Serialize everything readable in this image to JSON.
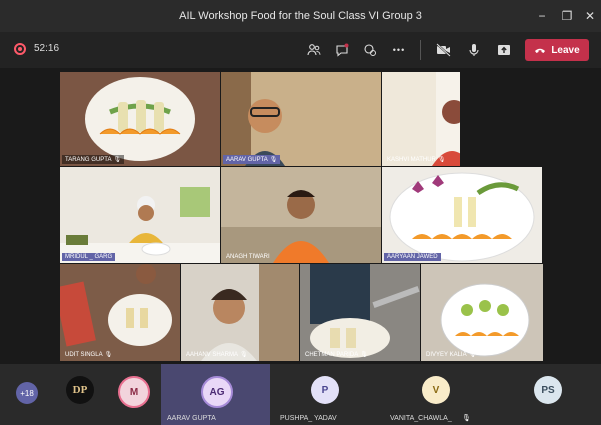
{
  "window": {
    "title": "AIL Workshop Food for the Soul Class VI Group 3",
    "minimize_glyph": "−",
    "maximize_glyph": "❐",
    "close_glyph": "✕"
  },
  "toolbar": {
    "timer": "52:16",
    "leave_label": "Leave",
    "more_glyph": "•••",
    "icons": [
      "participants-icon",
      "chat-icon",
      "reactions-icon",
      "more-icon",
      "camera-off-icon",
      "mic-icon",
      "share-icon"
    ]
  },
  "video_tiles": [
    {
      "name": "TARANG GUPTA",
      "highlight": false
    },
    {
      "name": "AARAV GUPTA",
      "highlight": true
    },
    {
      "name": "KASHVI MATHUR",
      "highlight": false
    },
    {
      "name": "MRIDUL _ GARG",
      "highlight": true
    },
    {
      "name": "ANAGH TIWARI",
      "highlight": false
    },
    {
      "name": "AARYAAN JAWED",
      "highlight": true
    },
    {
      "name": "UDIT SINGLA",
      "highlight": false
    },
    {
      "name": "AAHANV SHARMA",
      "highlight": false
    },
    {
      "name": "CHETMAN PARIDA",
      "highlight": false
    },
    {
      "name": "DIVYEY KALIA",
      "highlight": false
    }
  ],
  "bottom_bar": {
    "overflow_count": "+18",
    "participants": [
      {
        "initials": "DP",
        "name": "",
        "avatar_bg": "#111111",
        "avatar_fg": "#e0c38a"
      },
      {
        "initials": "M",
        "name": "",
        "avatar_bg": "#f2d4dc",
        "avatar_fg": "#8a2a45"
      },
      {
        "initials": "AG",
        "name": "AARAV GUPTA",
        "avatar_bg": "#e9d8f7",
        "avatar_fg": "#4b2a73"
      },
      {
        "initials": "P",
        "name": "PUSHPA_ YADAV",
        "avatar_bg": "#e3e1f8",
        "avatar_fg": "#4a4690"
      },
      {
        "initials": "V",
        "name": "VANITA_CHAWLA_",
        "avatar_bg": "#f9ecc9",
        "avatar_fg": "#8a6a12"
      },
      {
        "initials": "PS",
        "name": "",
        "avatar_bg": "#dbe6ee",
        "avatar_fg": "#3b4e5e"
      }
    ]
  },
  "colors": {
    "accent": "#6264a7",
    "leave": "#c4314b",
    "recording": "#ff5a6a"
  }
}
